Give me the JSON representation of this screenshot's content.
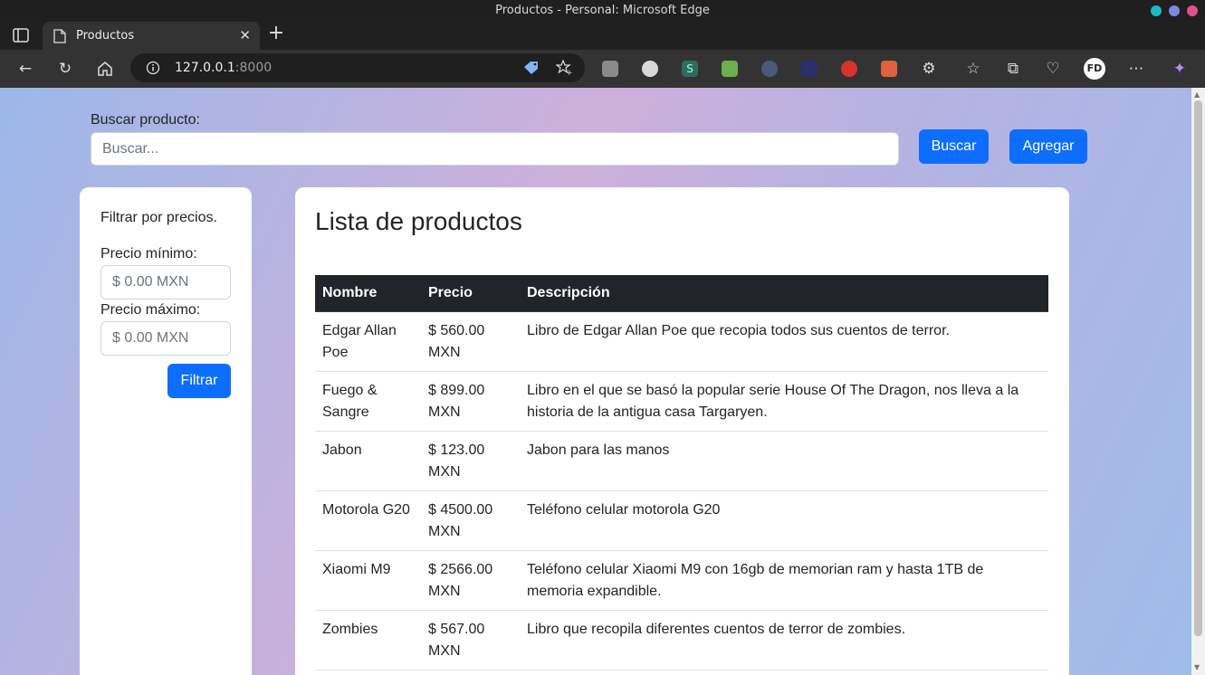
{
  "browser": {
    "window_title": "Productos - Personal: Microsoft Edge",
    "tab_title": "Productos",
    "url_host": "127.0.0.1",
    "url_port": ":8000"
  },
  "page": {
    "search": {
      "label": "Buscar producto:",
      "placeholder": "Buscar...",
      "search_button": "Buscar",
      "add_button": "Agregar"
    },
    "filter": {
      "title": "Filtrar por precios.",
      "min_label": "Precio mínimo:",
      "min_placeholder": "$ 0.00 MXN",
      "max_label": "Precio máximo:",
      "max_placeholder": "$ 0.00 MXN",
      "filter_button": "Filtrar"
    },
    "list": {
      "title": "Lista de productos",
      "headers": [
        "Nombre",
        "Precio",
        "Descripción"
      ],
      "rows": [
        {
          "name": "Edgar Allan Poe",
          "price": "$ 560.00 MXN",
          "description": "Libro de Edgar Allan Poe que recopia todos sus cuentos de terror."
        },
        {
          "name": "Fuego & Sangre",
          "price": "$ 899.00 MXN",
          "description": "Libro en el que se basó la popular serie House Of The Dragon, nos lleva a la historia de la antigua casa Targaryen."
        },
        {
          "name": "Jabon",
          "price": "$ 123.00 MXN",
          "description": "Jabon para las manos"
        },
        {
          "name": "Motorola G20",
          "price": "$ 4500.00 MXN",
          "description": "Teléfono celular motorola G20"
        },
        {
          "name": "Xiaomi M9",
          "price": "$ 2566.00 MXN",
          "description": "Teléfono celular Xiaomi M9 con 16gb de memorian ram y hasta 1TB de memoria expandible."
        },
        {
          "name": "Zombies",
          "price": "$ 567.00 MXN",
          "description": "Libro que recopila diferentes cuentos de terror de zombies."
        }
      ]
    }
  },
  "colors": {
    "primary_button": "#0d6efd",
    "table_header": "#212529"
  }
}
